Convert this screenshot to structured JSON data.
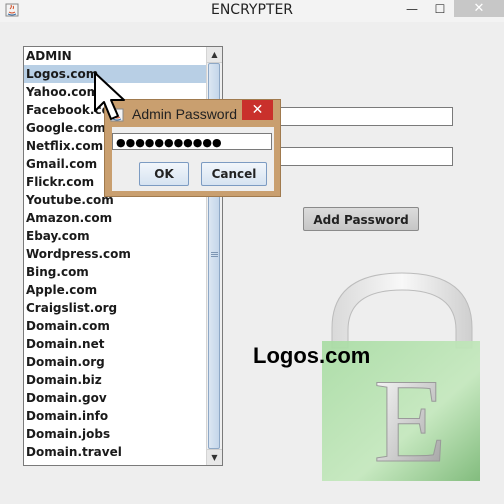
{
  "window": {
    "title": "ENCRYPTER",
    "minimize_glyph": "—",
    "maximize_glyph": "☐",
    "close_glyph": "✕"
  },
  "list": {
    "selected_index": 1,
    "items": [
      "ADMIN",
      "Logos.com",
      "Yahoo.com",
      "Facebook.com",
      "Google.com",
      "Netflix.com",
      "Gmail.com",
      "Flickr.com",
      "Youtube.com",
      "Amazon.com",
      "Ebay.com",
      "Wordpress.com",
      "Bing.com",
      "Apple.com",
      "Craigslist.org",
      "Domain.com",
      "Domain.net",
      "Domain.org",
      "Domain.biz",
      "Domain.gov",
      "Domain.info",
      "Domain.jobs",
      "Domain.travel"
    ]
  },
  "main": {
    "add_button": "Add Password",
    "selected_site_label": "Logos.com"
  },
  "dialog": {
    "title": "Admin Password",
    "password_value": "●●●●●●●●●●●",
    "ok_label": "OK",
    "cancel_label": "Cancel",
    "close_glyph": "✕"
  },
  "logo": {
    "letter": "E"
  },
  "colors": {
    "selection": "#b8cfe5",
    "dialog_frame": "#c99f6f",
    "dialog_close": "#c9302c",
    "lock_green": "#8fcf8a"
  }
}
